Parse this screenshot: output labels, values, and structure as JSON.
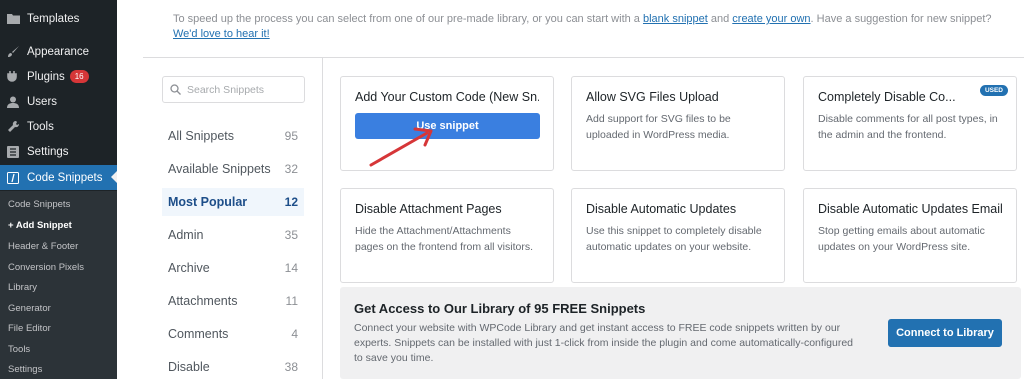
{
  "sidebar": {
    "menu": [
      {
        "label": "Templates",
        "icon": "folder-icon"
      },
      {
        "label": "Appearance",
        "icon": "paintbrush-icon"
      },
      {
        "label": "Plugins",
        "icon": "plug-icon",
        "badge": "16"
      },
      {
        "label": "Users",
        "icon": "user-icon"
      },
      {
        "label": "Tools",
        "icon": "wrench-icon"
      },
      {
        "label": "Settings",
        "icon": "settings-icon"
      },
      {
        "label": "Code Snippets",
        "icon": "code-icon"
      }
    ],
    "submenu": [
      "Code Snippets",
      "+ Add Snippet",
      "Header & Footer",
      "Conversion Pixels",
      "Library",
      "Generator",
      "File Editor",
      "Tools",
      "Settings"
    ]
  },
  "intro": {
    "text_1": "To speed up the process you can select from one of our pre-made library, or you can start with a ",
    "link_blank": "blank snippet",
    "text_2": " and ",
    "link_create": "create your own",
    "text_3": ". Have a suggestion for new snippet? ",
    "link_suggest": "We'd love to hear it!"
  },
  "search": {
    "placeholder": "Search Snippets"
  },
  "categories": [
    {
      "label": "All Snippets",
      "count": "95"
    },
    {
      "label": "Available Snippets",
      "count": "32"
    },
    {
      "label": "Most Popular",
      "count": "12"
    },
    {
      "label": "Admin",
      "count": "35"
    },
    {
      "label": "Archive",
      "count": "14"
    },
    {
      "label": "Attachments",
      "count": "11"
    },
    {
      "label": "Comments",
      "count": "4"
    },
    {
      "label": "Disable",
      "count": "38"
    }
  ],
  "cards": [
    {
      "title": "Add Your Custom Code (New Sn...",
      "button": "Use snippet"
    },
    {
      "title": "Allow SVG Files Upload",
      "desc": "Add support for SVG files to be uploaded in WordPress media."
    },
    {
      "title": "Completely Disable Co...",
      "desc": "Disable comments for all post types, in the admin and the frontend.",
      "badge": "USED"
    },
    {
      "title": "Disable Attachment Pages",
      "desc": "Hide the Attachment/Attachments pages on the frontend from all visitors."
    },
    {
      "title": "Disable Automatic Updates",
      "desc": "Use this snippet to completely disable automatic updates on your website."
    },
    {
      "title": "Disable Automatic Updates Emails",
      "desc": "Stop getting emails about automatic updates on your WordPress site."
    }
  ],
  "library": {
    "title": "Get Access to Our Library of 95 FREE Snippets",
    "desc": "Connect your website with WPCode Library and get instant access to FREE code snippets written by our experts. Snippets can be installed with just 1-click from inside the plugin and come automatically-configured to save you time.",
    "button": "Connect to Library"
  },
  "colors": {
    "accent": "#2271b1",
    "sidebar_bg": "#1d2327",
    "arrow": "#d63638"
  }
}
